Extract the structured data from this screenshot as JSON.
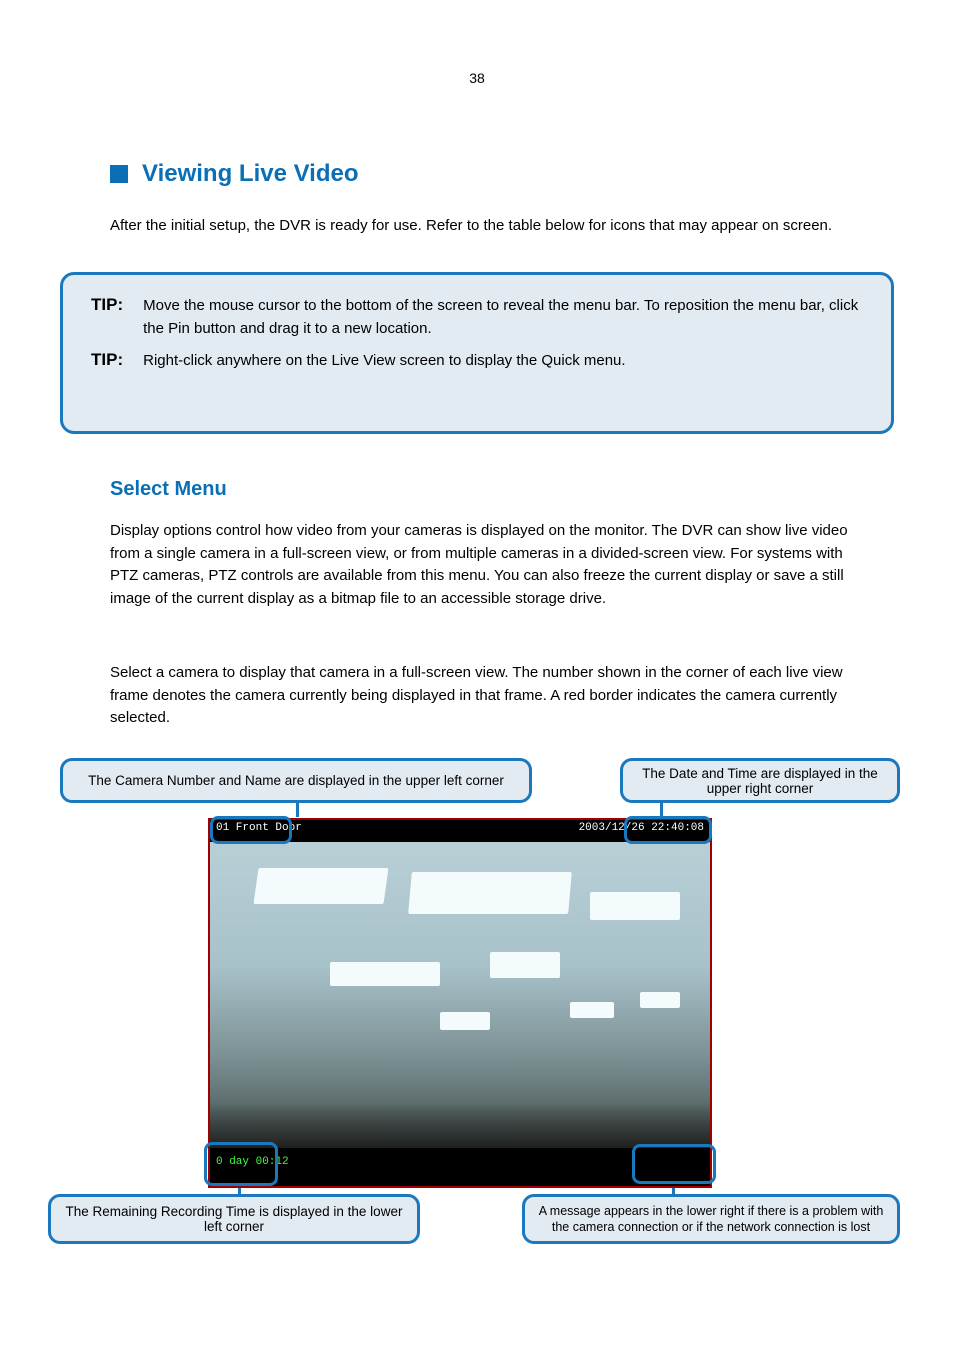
{
  "page_number": "38",
  "section": {
    "bullet_icon": "square",
    "title": "Viewing Live Video",
    "intro": "After the initial setup, the DVR is ready for use. Refer to the table below for icons that may appear on screen."
  },
  "tips": [
    {
      "label": "TIP:",
      "text": "Move the mouse cursor to the bottom of the screen to reveal the menu bar. To reposition the menu bar, click the Pin button and drag it to a new location."
    },
    {
      "label": "TIP:",
      "text": "Right-click anywhere on the Live View screen to display the Quick menu."
    }
  ],
  "subsection": {
    "title": "Select Menu",
    "p1": "Display options control how video from your cameras is displayed on the monitor. The DVR can show live video from a single camera in a full-screen view, or from multiple cameras in a divided-screen view. For systems with PTZ cameras, PTZ controls are available from this menu. You can also freeze the current display or save a still image of the current display as a bitmap file to an accessible storage drive.",
    "p2": "Select a camera to display that camera in a full-screen view. The number shown in the corner of each live view frame denotes the camera currently being displayed in that frame. A red border indicates the camera currently selected."
  },
  "callouts": {
    "top_left": "The Camera Number and Name are displayed in the upper left corner",
    "top_right": "The Date and Time are displayed in the upper right corner",
    "bottom_left": "The Remaining Recording Time is displayed in the lower left corner",
    "bottom_right": "A message appears in the lower right if there is a problem with the camera connection or if the network connection is lost"
  },
  "screenshot": {
    "camera_label": "01  Front Door",
    "datetime": "2003/12/26 22:40:08",
    "remaining_time": "0 day 00:12"
  }
}
